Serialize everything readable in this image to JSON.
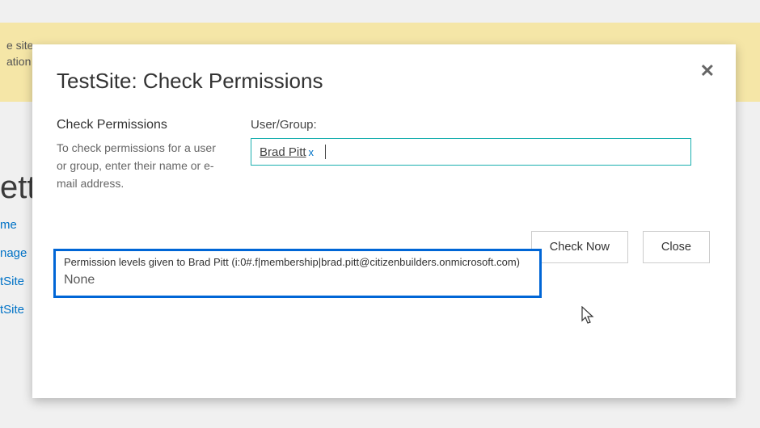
{
  "background": {
    "banner_line1": "e site",
    "banner_line2": "ation",
    "page_title_partial": "ett",
    "nav": [
      "me",
      "nage",
      "tSite",
      "tSite"
    ]
  },
  "dialog": {
    "title": "TestSite: Check Permissions",
    "close_glyph": "✕",
    "section_heading": "Check Permissions",
    "section_description": "To check permissions for a user or group, enter their name or e-mail address.",
    "field_label": "User/Group:",
    "picker_entity": "Brad Pitt",
    "picker_remove_glyph": "x",
    "check_button": "Check Now",
    "close_button": "Close"
  },
  "result": {
    "heading": "Permission levels given to Brad Pitt (i:0#.f|membership|brad.pitt@citizenbuilders.onmicrosoft.com)",
    "value": "None"
  }
}
